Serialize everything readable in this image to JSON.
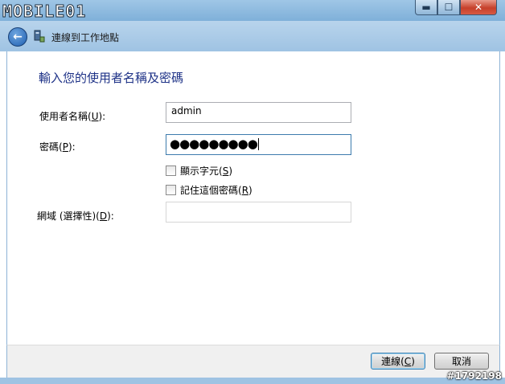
{
  "titlebar": {
    "logo": "MOBILE01"
  },
  "nav": {
    "title": "連線到工作地點"
  },
  "form": {
    "heading": "輸入您的使用者名稱及密碼",
    "username": {
      "label": "使用者名稱(",
      "key": "U",
      "suffix": "):",
      "value": "admin"
    },
    "password": {
      "label": "密碼(",
      "key": "P",
      "suffix": "):",
      "masked": "●●●●●●●●●"
    },
    "show_chars": {
      "label": "顯示字元(",
      "key": "S",
      "suffix": ")",
      "checked": false
    },
    "remember": {
      "label": "記住這個密碼(",
      "key": "R",
      "suffix": ")",
      "checked": false
    },
    "domain": {
      "label": "網域 (選擇性)(",
      "key": "D",
      "suffix": "):",
      "value": ""
    }
  },
  "buttons": {
    "connect": {
      "label": "連線(",
      "key": "C",
      "suffix": ")"
    },
    "cancel": {
      "label": "取消"
    }
  },
  "watermark": "#1792198"
}
